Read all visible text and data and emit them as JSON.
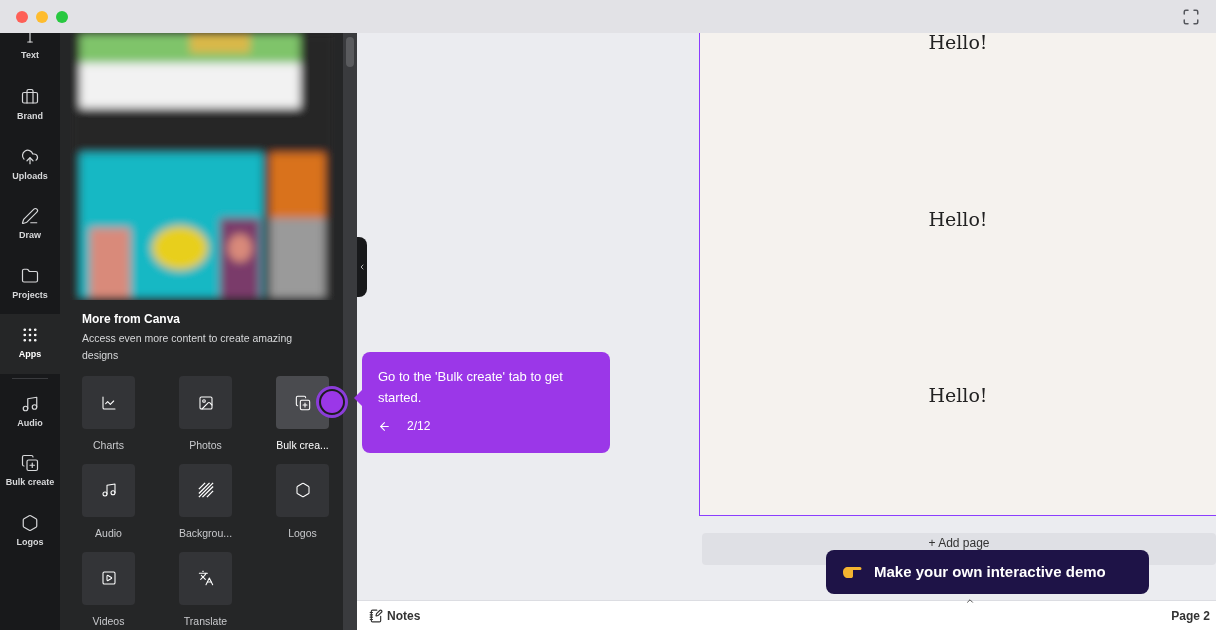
{
  "rail": [
    {
      "label": "Text",
      "kind": "text",
      "selected": false
    },
    {
      "label": "Brand",
      "kind": "brand",
      "selected": false
    },
    {
      "label": "Uploads",
      "kind": "upload",
      "selected": false
    },
    {
      "label": "Draw",
      "kind": "draw",
      "selected": false
    },
    {
      "label": "Projects",
      "kind": "folder",
      "selected": false
    },
    {
      "label": "Apps",
      "kind": "apps",
      "selected": true
    },
    {
      "label": "Audio",
      "kind": "audio",
      "selected": false
    },
    {
      "label": "Bulk create",
      "kind": "bulk",
      "selected": false
    },
    {
      "label": "Logos",
      "kind": "logo",
      "selected": false
    }
  ],
  "panel": {
    "title": "More from Canva",
    "description": "Access even more content to create amazing designs",
    "apps": [
      {
        "label": "Charts",
        "kind": "chart",
        "selected": false
      },
      {
        "label": "Photos",
        "selected": false
      },
      {
        "label": "Bulk crea...",
        "kind": "bulk",
        "selected": true
      },
      {
        "label": "Audio",
        "kind": "audio",
        "selected": false
      },
      {
        "label": "Backgrou...",
        "kind": "stripes",
        "selected": false
      },
      {
        "label": "Logos",
        "kind": "logo",
        "selected": false
      },
      {
        "label": "Videos",
        "kind": "video",
        "selected": false
      },
      {
        "label": "Translate",
        "kind": "translate",
        "selected": false
      }
    ]
  },
  "canvas": {
    "texts": [
      "Hello!",
      "Hello!",
      "Hello!"
    ],
    "add_page": "+ Add page"
  },
  "tooltip": {
    "text": "Go to the 'Bulk create' tab to get started.",
    "step": "2/12"
  },
  "demo_button": "Make your own interactive demo",
  "footer": {
    "notes": "Notes",
    "page": "Page 2"
  }
}
